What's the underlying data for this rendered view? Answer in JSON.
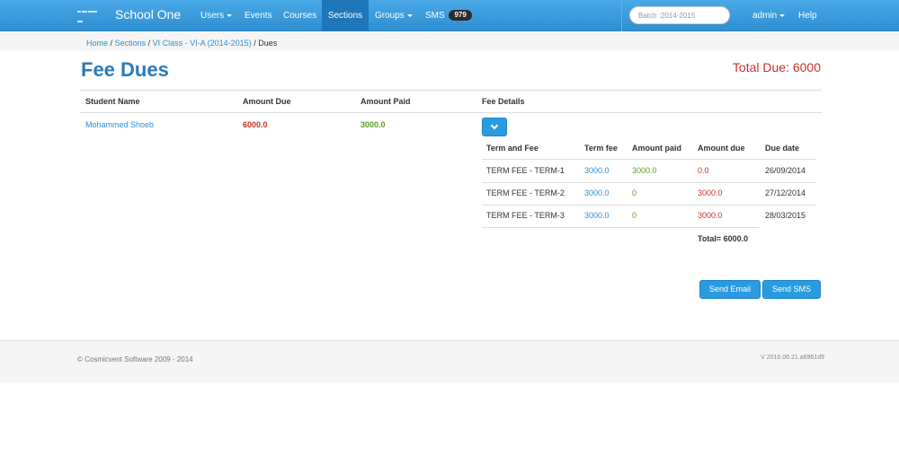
{
  "navbar": {
    "brand": "School One",
    "items": [
      {
        "label": "Users",
        "dropdown": true
      },
      {
        "label": "Events",
        "dropdown": false
      },
      {
        "label": "Courses",
        "dropdown": false
      },
      {
        "label": "Sections",
        "dropdown": false,
        "active": true
      },
      {
        "label": "Groups",
        "dropdown": true
      },
      {
        "label": "SMS",
        "dropdown": false
      }
    ],
    "sms_count": "979",
    "batch_placeholder": "Batch :2014-2015",
    "user_label": "admin",
    "help_label": "Help"
  },
  "breadcrumb": {
    "home": "Home",
    "sections": "Sections",
    "class": "VI Class - VI-A (2014-2015)",
    "current": "Dues",
    "separator": "/"
  },
  "page": {
    "title": "Fee Dues",
    "total_due": "Total Due: 6000"
  },
  "table": {
    "headers": [
      "Student Name",
      "Amount Due",
      "Amount Paid",
      "Fee Details"
    ],
    "row": {
      "student": "Mohammed Shoeb",
      "amount_due": "6000.0",
      "amount_paid": "3000.0"
    }
  },
  "fee_details": {
    "headers": [
      "Term and Fee",
      "Term fee",
      "Amount paid",
      "Amount due",
      "Due date"
    ],
    "rows": [
      {
        "term": "TERM FEE - TERM-1",
        "fee": "3000.0",
        "paid": "3000.0",
        "due": "0.0",
        "date": "26/09/2014"
      },
      {
        "term": "TERM FEE - TERM-2",
        "fee": "3000.0",
        "paid": "0",
        "due": "3000.0",
        "date": "27/12/2014"
      },
      {
        "term": "TERM FEE - TERM-3",
        "fee": "3000.0",
        "paid": "0",
        "due": "3000.0",
        "date": "28/03/2015"
      }
    ],
    "total": "Total= 6000.0"
  },
  "actions": {
    "send_email": "Send Email",
    "send_sms": "Send SMS"
  },
  "footer": {
    "copyright": "© Cosmicvent Software 2009 - 2014",
    "version": "V 2016.06.21.a6961d9"
  }
}
